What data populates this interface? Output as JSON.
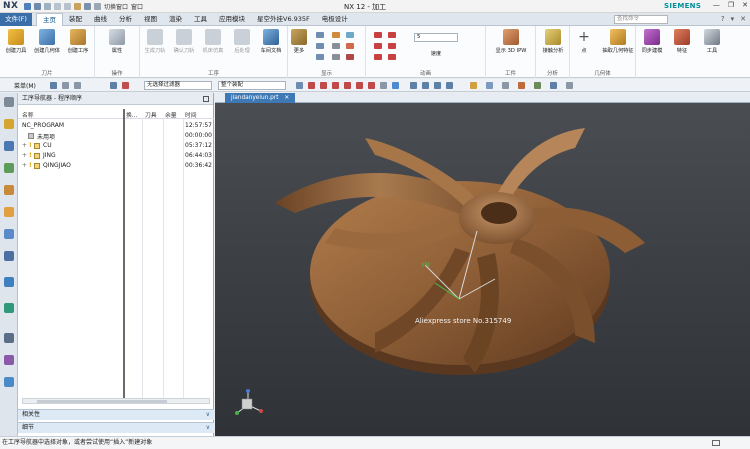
{
  "app": {
    "logo": "NX",
    "window_title": "NX 12 - 加工",
    "brand": "SIEMENS",
    "qat_switch_window": "切换窗口",
    "qat_window": "窗口"
  },
  "menu": {
    "file": "文件(F)",
    "tabs": [
      "主页",
      "装配",
      "曲线",
      "分析",
      "视图",
      "渲染",
      "工具",
      "应用模块",
      "星空外挂V6.935F",
      "电极设计"
    ],
    "search_placeholder": "查找命令"
  },
  "ribbon": {
    "groups": [
      {
        "label": "刀片",
        "buttons": [
          "创建刀具",
          "创建几何体",
          "创建工序"
        ]
      },
      {
        "label": "操作",
        "buttons": [
          "属性"
        ]
      },
      {
        "label": "工序",
        "buttons": [
          "生成刀轨",
          "确认刀轨",
          "机床仿真",
          "后处理",
          "车间文档"
        ]
      },
      {
        "label": "显示",
        "buttons": [
          "更多"
        ]
      },
      {
        "label": "动画",
        "buttons": [
          "速度"
        ]
      },
      {
        "label": "工件",
        "buttons": [
          "显示 3D IPW"
        ]
      },
      {
        "label": "分析",
        "buttons": [
          "接触分析"
        ]
      },
      {
        "label": "几何体",
        "buttons": [
          "点",
          "抽取几何特征"
        ]
      },
      {
        "label": "",
        "buttons": [
          "同步建模",
          "特征",
          "工具"
        ]
      }
    ],
    "speed_value": "5"
  },
  "toolbar": {
    "menu_label": "菜单(M)",
    "filter_value": "无选择过滤器",
    "scope_value": "整个装配"
  },
  "navigator": {
    "title": "工序导航器 - 程序顺序",
    "columns": [
      "名称",
      "换...",
      "刀具",
      "余量",
      "时间"
    ],
    "rows": [
      {
        "name": "NC_PROGRAM",
        "time": "12:57:57"
      },
      {
        "name": "未用项",
        "time": "00:00:00"
      },
      {
        "name": "CU",
        "time": "05:37:12"
      },
      {
        "name": "JING",
        "time": "06:44:03"
      },
      {
        "name": "QINGJIAO",
        "time": "00:36:42"
      }
    ],
    "sections": [
      "相关性",
      "细节"
    ]
  },
  "viewport": {
    "tab_label": "jiandanyelun.prt",
    "watermark": "Aliexpress store No.315749",
    "axis_label": "YM"
  },
  "status": {
    "message": "在工序导航器中选择对象，或者尝试使用“插入”新建对象"
  },
  "colors": {
    "accent_blue": "#3a6ea8",
    "impeller_bronze": "#9a6a40",
    "viewport_bg": "#3d4045"
  }
}
